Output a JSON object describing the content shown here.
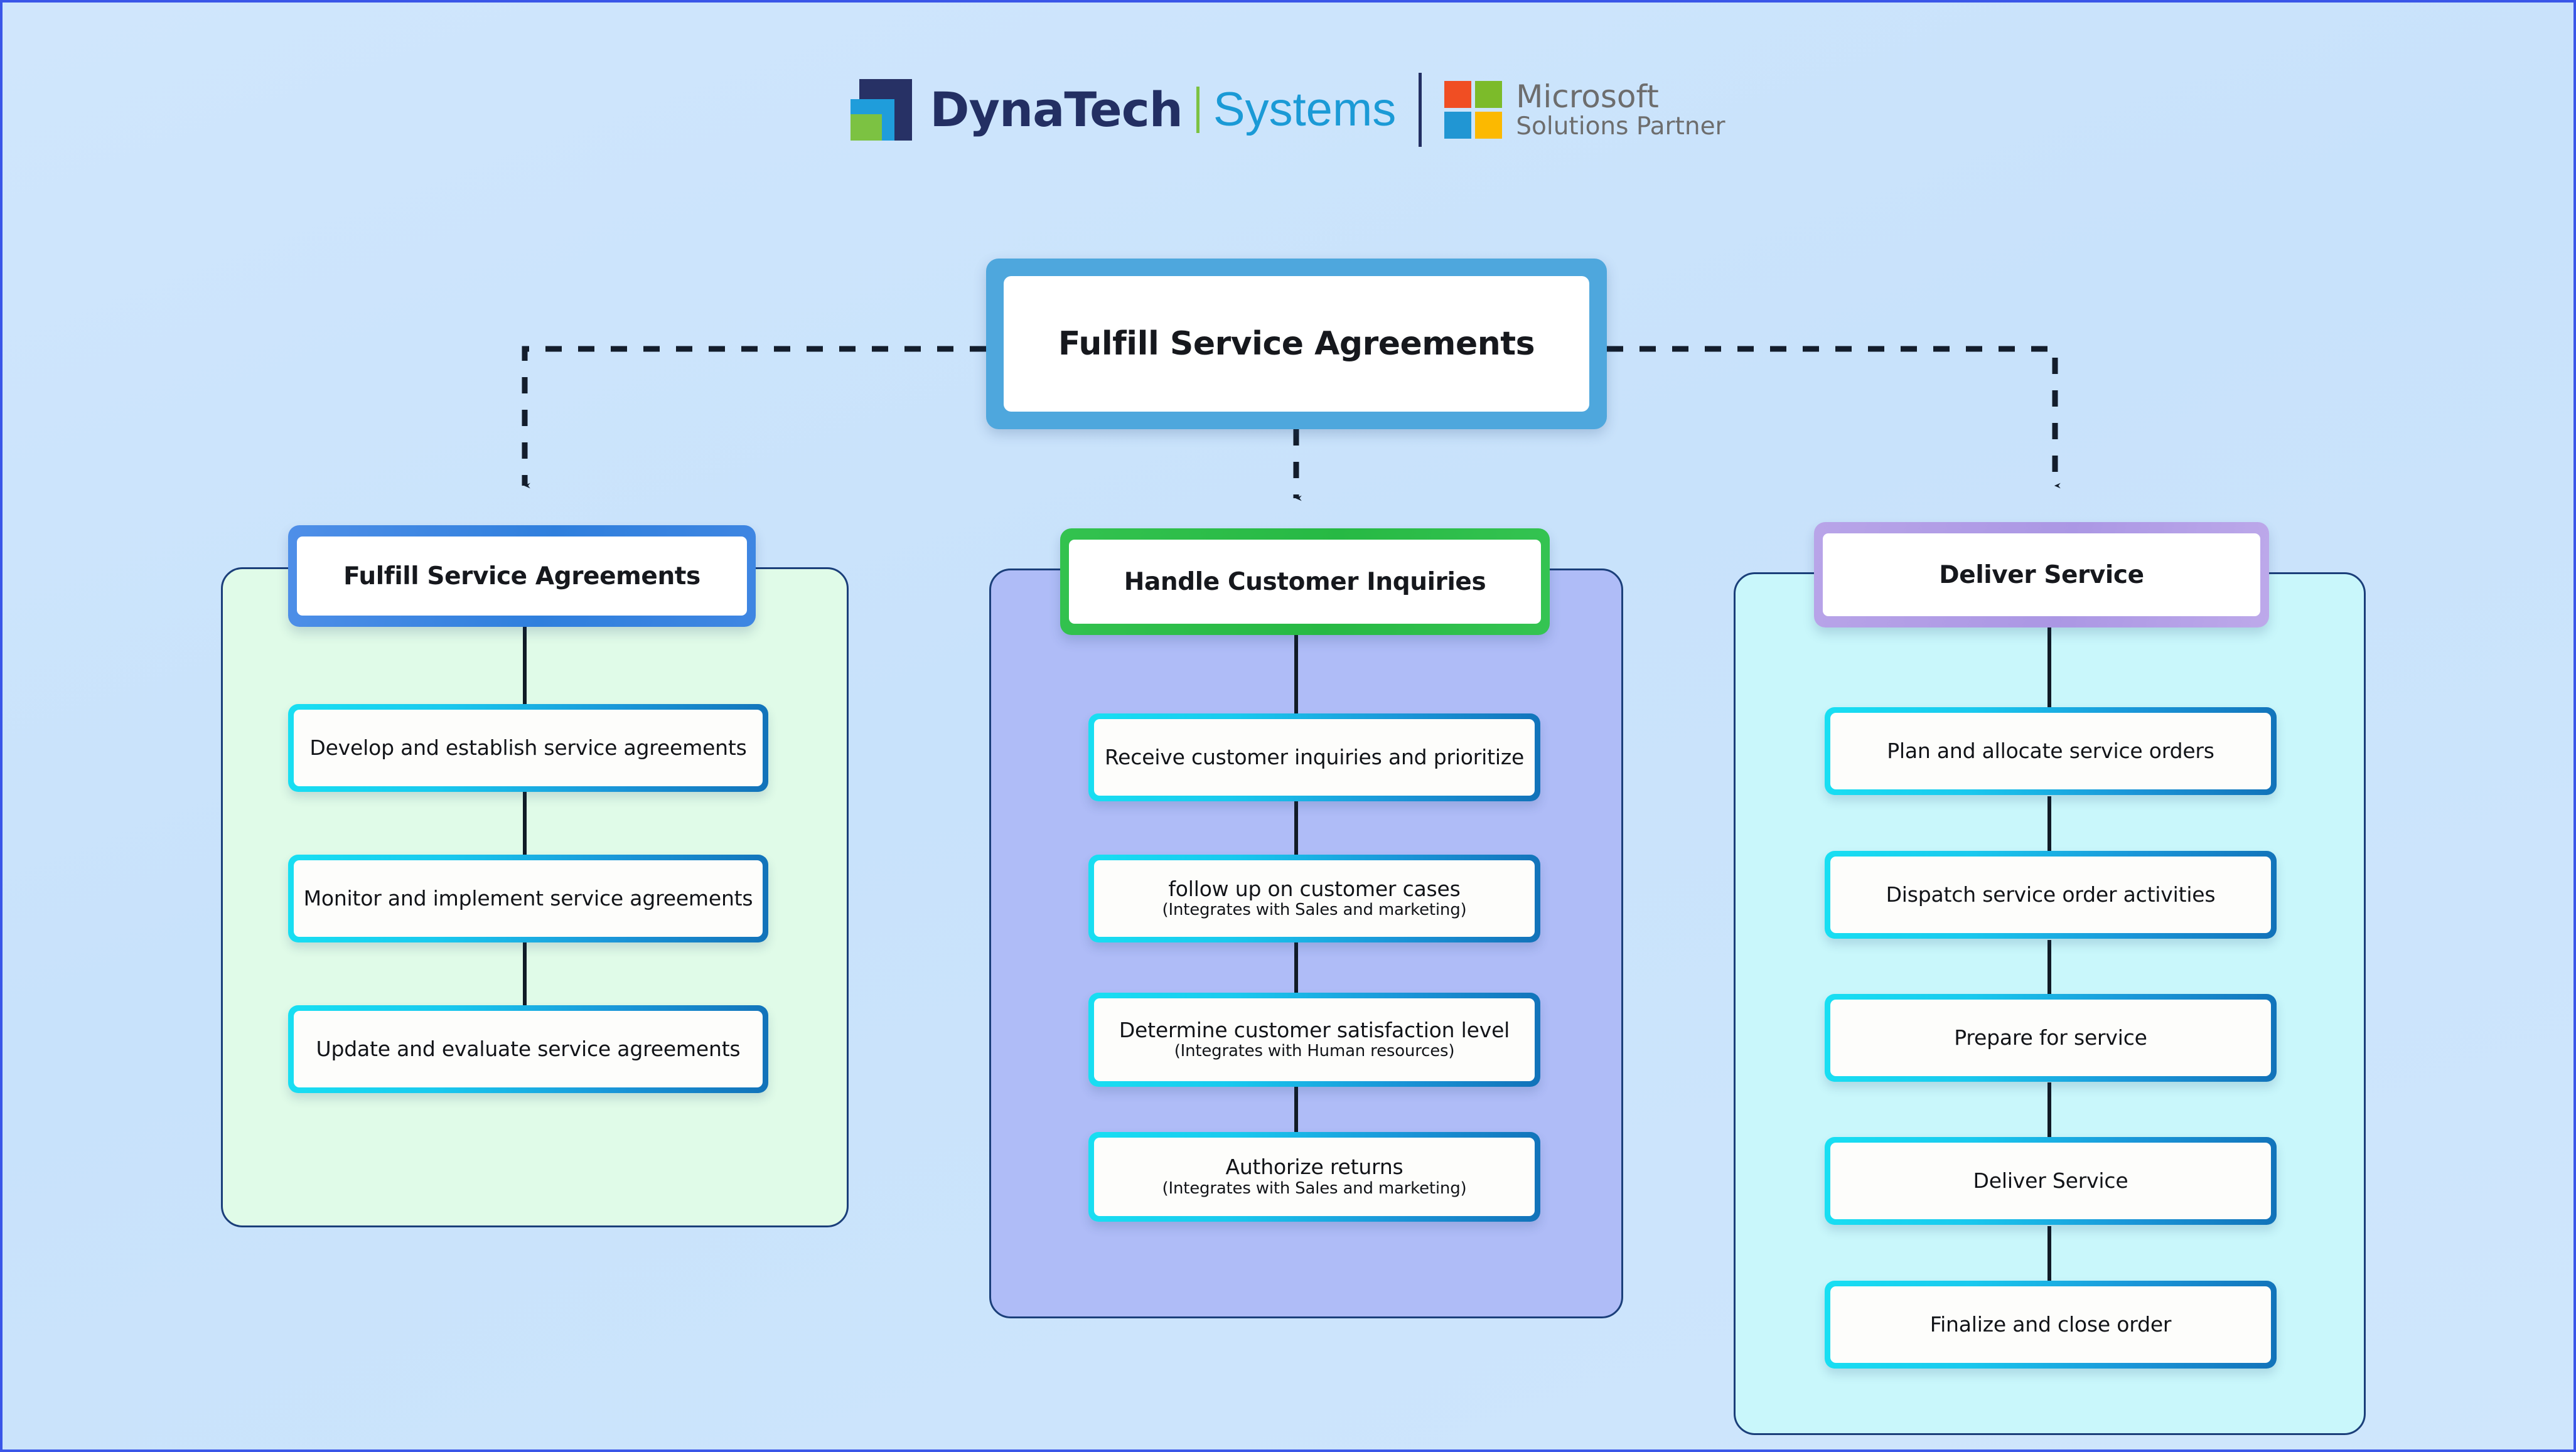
{
  "brand": {
    "logo_mark": "dynatech-logo-mark",
    "company": "DynaTech",
    "product": "Systems",
    "partner_squares_icon": "microsoft-squares-icon",
    "partner_line1": "Microsoft",
    "partner_line2": "Solutions Partner",
    "colors": {
      "navy": "#232f63",
      "cyan": "#1f9ddb",
      "green": "#7cc242",
      "systems_blue": "#1b9ad6",
      "ms_red": "#f04e23",
      "ms_green": "#7cbb2a",
      "ms_blue": "#2196d3",
      "ms_yellow": "#fcb900",
      "ms_gray": "#6d6d6d"
    }
  },
  "diagram": {
    "root": {
      "label": "Fulfill Service Agreements",
      "border_color": "#4ea7dd"
    },
    "columns": [
      {
        "header": "Fulfill Service Agreements",
        "header_border_color": "#3f86e2",
        "panel_color": "#e0fbe8",
        "steps": [
          {
            "main": "Develop and establish service agreements",
            "sub": ""
          },
          {
            "main": "Monitor and implement service agreements",
            "sub": ""
          },
          {
            "main": "Update and evaluate service agreements",
            "sub": ""
          }
        ]
      },
      {
        "header": "Handle Customer Inquiries",
        "header_border_color": "#27b944",
        "panel_color": "#afbcf7",
        "steps": [
          {
            "main": "Receive customer inquiries and prioritize",
            "sub": ""
          },
          {
            "main": "follow up on customer cases",
            "sub": "(Integrates with Sales and marketing)"
          },
          {
            "main": "Determine customer satisfaction level",
            "sub": "(Integrates with Human resources)"
          },
          {
            "main": "Authorize returns",
            "sub": "(Integrates with Sales and marketing)"
          }
        ]
      },
      {
        "header": "Deliver Service",
        "header_border_color": "#ab97e4",
        "panel_color": "#c9f7fb",
        "steps": [
          {
            "main": "Plan and allocate service orders",
            "sub": ""
          },
          {
            "main": "Dispatch service order activities",
            "sub": ""
          },
          {
            "main": "Prepare for service",
            "sub": ""
          },
          {
            "main": "Deliver Service",
            "sub": ""
          },
          {
            "main": "Finalize and close order",
            "sub": ""
          }
        ]
      }
    ],
    "connector_style": "dashed",
    "connector_color": "#131d2c",
    "background_color": "#cbe4fb"
  }
}
